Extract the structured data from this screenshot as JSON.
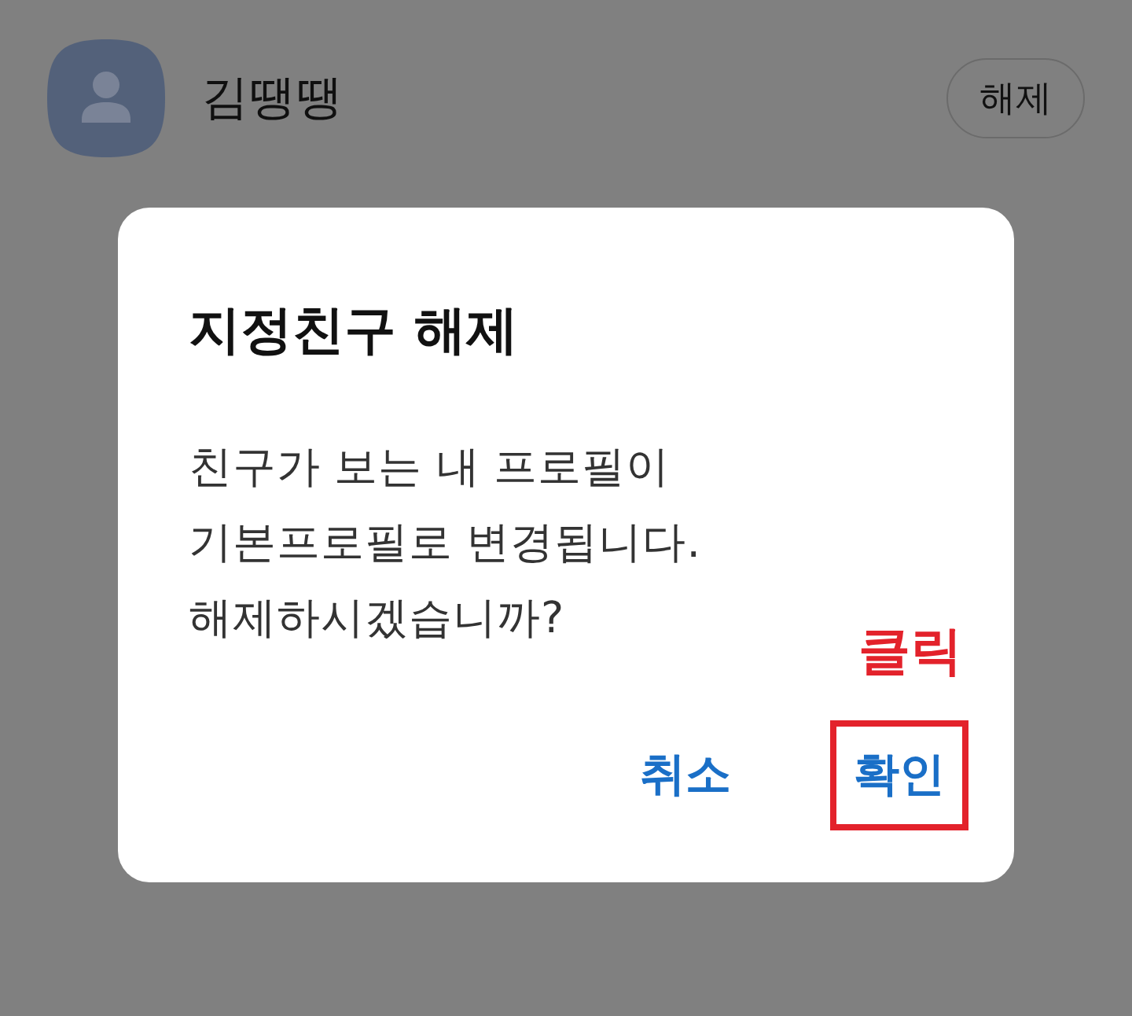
{
  "list_item": {
    "name": "김땡땡",
    "action": "해제"
  },
  "dialog": {
    "title": "지정친구 해제",
    "message": "친구가 보는 내 프로필이\n기본프로필로 변경됩니다.\n해제하시겠습니까?",
    "buttons": [
      {
        "label": "취소",
        "highlighted": false
      },
      {
        "label": "확인",
        "highlighted": true
      }
    ]
  },
  "annotation": {
    "text": "클릭"
  }
}
